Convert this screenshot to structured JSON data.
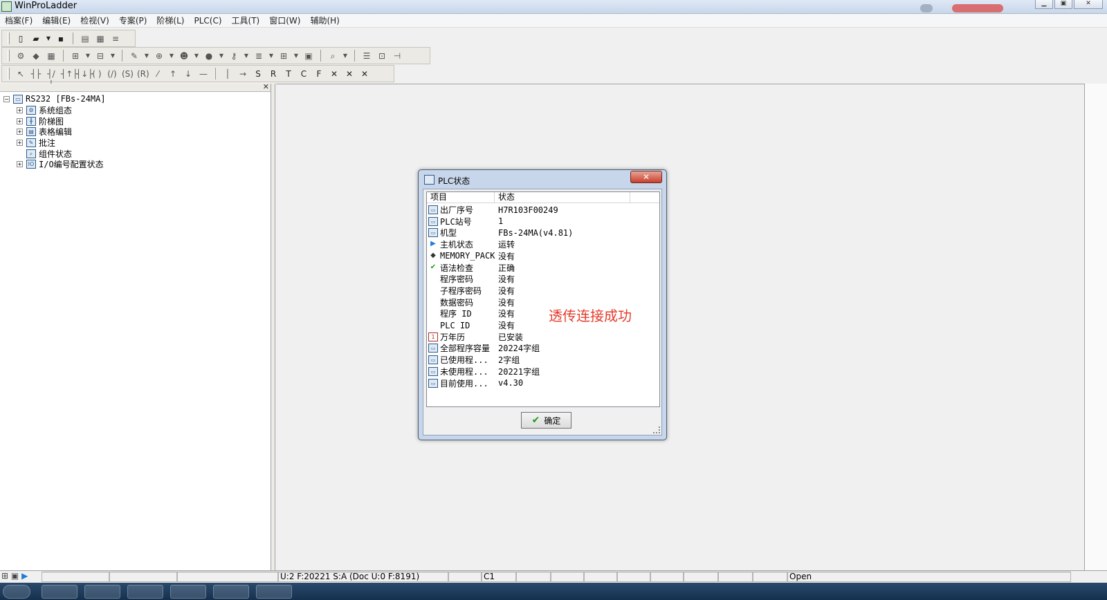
{
  "app": {
    "title": "WinProLadder"
  },
  "menu": [
    "档案(F)",
    "编辑(E)",
    "检视(V)",
    "专案(P)",
    "阶梯(L)",
    "PLC(C)",
    "工具(T)",
    "窗口(W)",
    "辅助(H)"
  ],
  "tree": {
    "root": "RS232 [FBs-24MA]",
    "items": [
      {
        "label": "系统组态",
        "icon": "system-config-icon",
        "expandable": true
      },
      {
        "label": "阶梯图",
        "icon": "ladder-icon",
        "expandable": true
      },
      {
        "label": "表格编辑",
        "icon": "table-edit-icon",
        "expandable": true
      },
      {
        "label": "批注",
        "icon": "comment-icon",
        "expandable": true
      },
      {
        "label": "组件状态",
        "icon": "component-status-icon",
        "expandable": false
      },
      {
        "label": "I/O编号配置状态",
        "icon": "io-config-icon",
        "expandable": true
      }
    ]
  },
  "dialog": {
    "title": "PLC状态",
    "columns": [
      "项目",
      "状态"
    ],
    "rows": [
      {
        "icon": "plc-icon",
        "item": "出厂序号",
        "value": "H7R103F00249"
      },
      {
        "icon": "plc-icon",
        "item": "PLC站号",
        "value": "1"
      },
      {
        "icon": "plc-icon",
        "item": "机型",
        "value": "FBs-24MA(v4.81)"
      },
      {
        "icon": "run-icon",
        "item": "主机状态",
        "value": "运转"
      },
      {
        "icon": "memory-pack-icon",
        "item": "MEMORY_PACK",
        "value": "没有"
      },
      {
        "icon": "check-icon",
        "item": "语法检查",
        "value": "正确"
      },
      {
        "icon": "",
        "item": "程序密码",
        "value": "没有"
      },
      {
        "icon": "",
        "item": "子程序密码",
        "value": "没有"
      },
      {
        "icon": "",
        "item": "数据密码",
        "value": "没有"
      },
      {
        "icon": "",
        "item": "程序 ID",
        "value": "没有"
      },
      {
        "icon": "",
        "item": "PLC ID",
        "value": "没有"
      },
      {
        "icon": "calendar-icon",
        "item": "万年历",
        "value": "已安装"
      },
      {
        "icon": "plc-icon",
        "item": "全部程序容量",
        "value": "20224字组"
      },
      {
        "icon": "plc-icon",
        "item": "已使用程...",
        "value": "2字组"
      },
      {
        "icon": "plc-icon",
        "item": "未使用程...",
        "value": "20221字组"
      },
      {
        "icon": "plc-icon",
        "item": "目前使用...",
        "value": "v4.30"
      }
    ],
    "annotation": "透传连接成功",
    "ok_label": "确定"
  },
  "status": {
    "memory": "U:2 F:20221 S:A (Doc U:0 F:8191)",
    "cursor": "C1",
    "state": "Open"
  }
}
